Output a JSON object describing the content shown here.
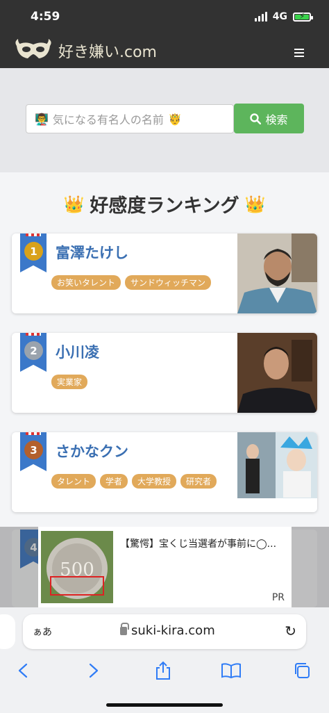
{
  "status": {
    "time": "4:59",
    "network": "4G"
  },
  "site": {
    "name": "好き嫌い.com"
  },
  "search": {
    "placeholder": "気になる有名人の名前",
    "button_label": "検索"
  },
  "ranking": {
    "title": "好感度ランキング",
    "entries": [
      {
        "rank": "1",
        "name": "富澤たけし",
        "tags": [
          "お笑いタレント",
          "サンドウィッチマン"
        ],
        "medal_color": "#d9a21b"
      },
      {
        "rank": "2",
        "name": "小川凌",
        "tags": [
          "実業家"
        ],
        "medal_color": "#9aa3ad"
      },
      {
        "rank": "3",
        "name": "さかなクン",
        "tags": [
          "タレント",
          "学者",
          "大学教授",
          "研究者"
        ],
        "medal_color": "#b3602c"
      }
    ],
    "next_rank": "4"
  },
  "ad": {
    "headline": "【驚愕】宝くじ当選者が事前に◯...",
    "label": "PR",
    "coin_text": "500"
  },
  "browser": {
    "aa_label": "ぁあ",
    "url": "suki-kira.com"
  }
}
